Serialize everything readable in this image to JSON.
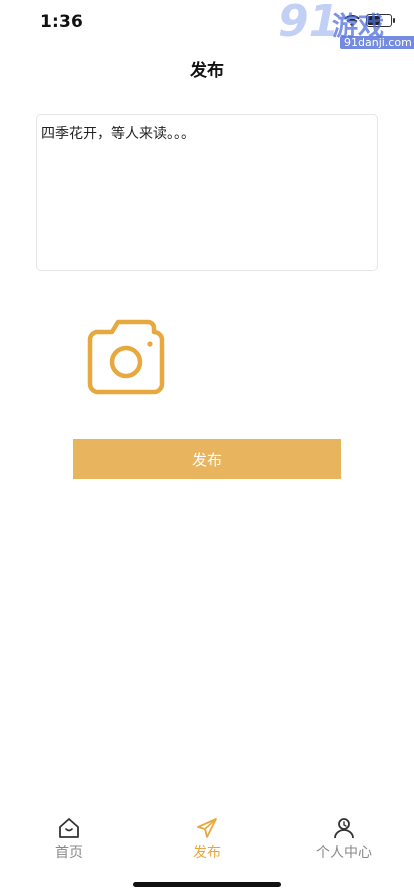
{
  "status_bar": {
    "time": "1:36",
    "battery_level": 0.6
  },
  "watermark": {
    "number": "91",
    "brand": "游戏",
    "url": "91danji.com"
  },
  "header": {
    "title": "发布"
  },
  "post": {
    "text": "四季花开，等人来读。。。"
  },
  "actions": {
    "publish_label": "发布"
  },
  "tab_bar": {
    "items": [
      {
        "label": "首页",
        "icon": "home-icon",
        "active": false
      },
      {
        "label": "发布",
        "icon": "send-icon",
        "active": true
      },
      {
        "label": "个人中心",
        "icon": "user-icon",
        "active": false
      }
    ]
  },
  "colors": {
    "accent": "#e8b45e",
    "tab_active": "#e7a83e",
    "tab_inactive": "#8a8a8a"
  }
}
